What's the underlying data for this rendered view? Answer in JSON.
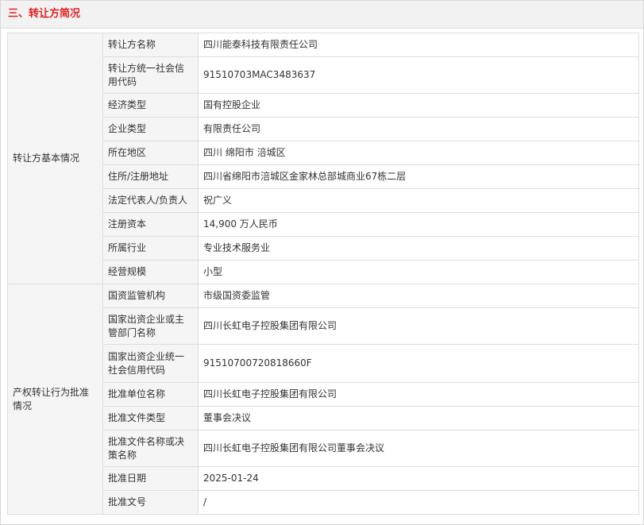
{
  "section": {
    "title": "三、转让方简况",
    "title_color": "#e02020"
  },
  "groups": [
    {
      "label": "转让方基本情况",
      "rows": [
        {
          "label": "转让方名称",
          "value": "四川能泰科技有限责任公司"
        },
        {
          "label": "转让方统一社会信用代码",
          "value": "91510703MAC3483637"
        },
        {
          "label": "经济类型",
          "value": "国有控股企业"
        },
        {
          "label": "企业类型",
          "value": "有限责任公司"
        },
        {
          "label": "所在地区",
          "value": "四川 绵阳市 涪城区"
        },
        {
          "label": "住所/注册地址",
          "value": "四川省绵阳市涪城区金家林总部城商业67栋二层"
        },
        {
          "label": "法定代表人/负责人",
          "value": "祝广义"
        },
        {
          "label": "注册资本",
          "value": "14,900 万人民币"
        },
        {
          "label": "所属行业",
          "value": "专业技术服务业"
        },
        {
          "label": "经营规模",
          "value": "小型"
        }
      ]
    },
    {
      "label": "产权转让行为批准情况",
      "rows": [
        {
          "label": "国资监管机构",
          "value": "市级国资委监管"
        },
        {
          "label": "国家出资企业或主管部门名称",
          "value": "四川长虹电子控股集团有限公司"
        },
        {
          "label": "国家出资企业统一社会信用代码",
          "value": "91510700720818660F"
        },
        {
          "label": "批准单位名称",
          "value": "四川长虹电子控股集团有限公司"
        },
        {
          "label": "批准文件类型",
          "value": "董事会决议"
        },
        {
          "label": "批准文件名称或决策名称",
          "value": "四川长虹电子控股集团有限公司董事会决议"
        },
        {
          "label": "批准日期",
          "value": "2025-01-24"
        },
        {
          "label": "批准文号",
          "value": "/"
        }
      ]
    }
  ]
}
